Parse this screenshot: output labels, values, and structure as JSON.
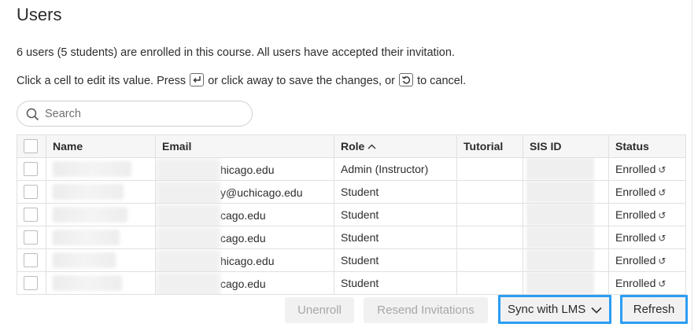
{
  "page": {
    "title": "Users",
    "summary": "6 users (5 students) are enrolled in this course. All users have accepted their invitation.",
    "instructions_part1": "Click a cell to edit its value. Press",
    "instructions_part2": "or click away to save the changes, or",
    "instructions_part3": "to cancel."
  },
  "search": {
    "placeholder": "Search"
  },
  "table": {
    "columns": {
      "name": "Name",
      "email": "Email",
      "role": "Role",
      "tutorial": "Tutorial",
      "sis_id": "SIS ID",
      "status": "Status"
    },
    "rows": [
      {
        "email_visible": "hicago.edu",
        "role": "Admin (Instructor)",
        "status": "Enrolled"
      },
      {
        "email_visible": "y@uchicago.edu",
        "role": "Student",
        "status": "Enrolled"
      },
      {
        "email_visible": "cago.edu",
        "role": "Student",
        "status": "Enrolled"
      },
      {
        "email_visible": "cago.edu",
        "role": "Student",
        "status": "Enrolled"
      },
      {
        "email_visible": "hicago.edu",
        "role": "Student",
        "status": "Enrolled"
      },
      {
        "email_visible": "cago.edu",
        "role": "Student",
        "status": "Enrolled"
      }
    ]
  },
  "actions": {
    "unenroll": "Unenroll",
    "resend": "Resend Invitations",
    "sync": "Sync with LMS",
    "refresh": "Refresh"
  },
  "colors": {
    "focus_ring": "#2a9df4",
    "disabled_text": "#a7a7a7"
  }
}
